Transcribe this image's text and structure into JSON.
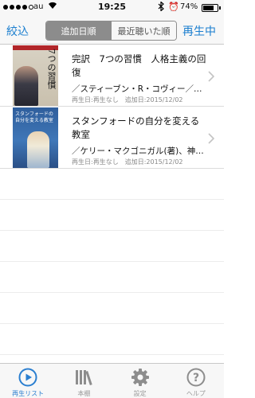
{
  "status_bar": {
    "carrier": "au",
    "time": "19:25",
    "battery_percent": "74%",
    "battery_level": 0.74,
    "signal_dots_filled": 4,
    "signal_dots_total": 5
  },
  "nav": {
    "left_button": "絞込",
    "right_button": "再生中",
    "segments": [
      "追加日順",
      "最近聴いた順"
    ],
    "active_segment": 0
  },
  "books": [
    {
      "title": "完訳　7つの習慣　人格主義の回復",
      "author": "／スティーブン・R・コヴィー／著...",
      "meta": "再生日:再生なし　追加日:2015/12/02",
      "cover_text": "7つの習慣"
    },
    {
      "title": "スタンフォードの自分を変える教室",
      "author": "／ケリー・マクゴニガル(著)、神崎...",
      "meta": "再生日:再生なし　追加日:2015/12/02",
      "cover_text": "スタンフォードの自分を変える教室"
    }
  ],
  "tabs": [
    {
      "label": "再生リスト",
      "icon": "play-circle-icon"
    },
    {
      "label": "本棚",
      "icon": "bookshelf-icon"
    },
    {
      "label": "設定",
      "icon": "gear-icon"
    },
    {
      "label": "ヘルプ",
      "icon": "help-icon"
    }
  ],
  "colors": {
    "accent": "#1a7ecf",
    "active_tab": "#2b7fd0",
    "inactive_tab": "#9a9a9a"
  }
}
